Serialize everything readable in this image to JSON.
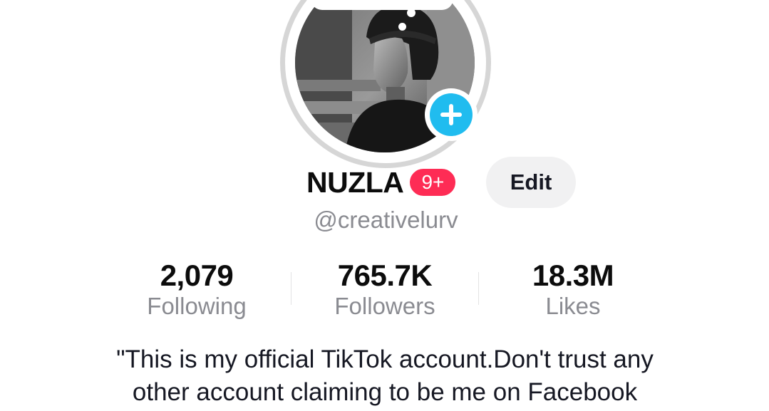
{
  "profile": {
    "display_name": "NUZLA",
    "notification_badge": "9+",
    "edit_label": "Edit",
    "handle": "@creativelurv",
    "avatar_icon": "profile-photo",
    "add_icon": "plus-icon"
  },
  "stats": {
    "following": {
      "value": "2,079",
      "label": "Following"
    },
    "followers": {
      "value": "765.7K",
      "label": "Followers"
    },
    "likes": {
      "value": "18.3M",
      "label": "Likes"
    }
  },
  "bio": {
    "line1": "\"This is my official TikTok account.Don't trust any",
    "line2": "other account claiming to be me on Facebook"
  },
  "colors": {
    "accent_blue": "#20bcef",
    "badge_red": "#fe2c55",
    "muted_text": "#8a8b91",
    "edit_bg": "#f1f1f2"
  }
}
